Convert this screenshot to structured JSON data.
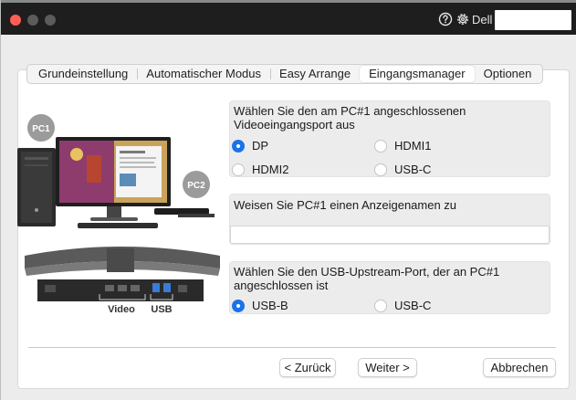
{
  "titlebar": {
    "user_label": "Dell",
    "icons": [
      "help-icon",
      "gear-icon"
    ]
  },
  "tabs": [
    {
      "label": "Grundeinstellung",
      "active": false
    },
    {
      "label": "Automatischer Modus",
      "active": false
    },
    {
      "label": "Easy Arrange",
      "active": false
    },
    {
      "label": "Eingangsmanager",
      "active": true
    },
    {
      "label": "Optionen",
      "active": false
    }
  ],
  "illustration": {
    "badge_pc1": "PC1",
    "badge_pc2": "PC2",
    "label_video": "Video",
    "label_usb": "USB"
  },
  "video_port": {
    "title": "Wählen Sie den am PC#1 angeschlossenen Videoeingangsport aus",
    "options": [
      {
        "label": "DP",
        "selected": true
      },
      {
        "label": "HDMI1",
        "selected": false
      },
      {
        "label": "HDMI2",
        "selected": false
      },
      {
        "label": "USB-C",
        "selected": false
      }
    ]
  },
  "display_name": {
    "title": "Weisen Sie PC#1 einen Anzeigenamen zu",
    "value": ""
  },
  "usb_upstream": {
    "title": "Wählen Sie den USB-Upstream-Port, der an PC#1 angeschlossen ist",
    "options": [
      {
        "label": "USB-B",
        "selected": true
      },
      {
        "label": "USB-C",
        "selected": false
      }
    ]
  },
  "buttons": {
    "back": "< Zurück",
    "next": "Weiter >",
    "cancel": "Abbrechen"
  },
  "colors": {
    "accent": "#1a73e8",
    "titlebar": "#1e1e1e",
    "close": "#ff5f57"
  }
}
